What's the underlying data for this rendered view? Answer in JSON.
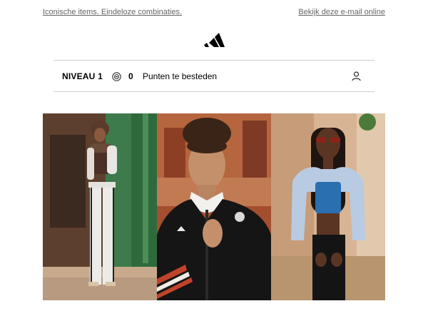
{
  "preheader": {
    "left_link": "Iconische items. Eindeloze combinaties.",
    "right_link": "Bekijk deze e-mail online"
  },
  "brand": {
    "logo_icon": "adidas-logo-icon"
  },
  "loyalty": {
    "level": "NIVEAU 1",
    "coin_icon": "coin-icon",
    "points": "0",
    "points_label": "Punten te besteden",
    "account_icon": "user-icon"
  },
  "colors": {
    "text_muted": "#666666",
    "divider": "#cfcfcf",
    "track_green": "#3d7a4c",
    "jacket_black": "#151515",
    "stripe_red": "#c2432b",
    "jacket_blue": "#b8cbe2",
    "top_blue": "#2a6fb0"
  }
}
